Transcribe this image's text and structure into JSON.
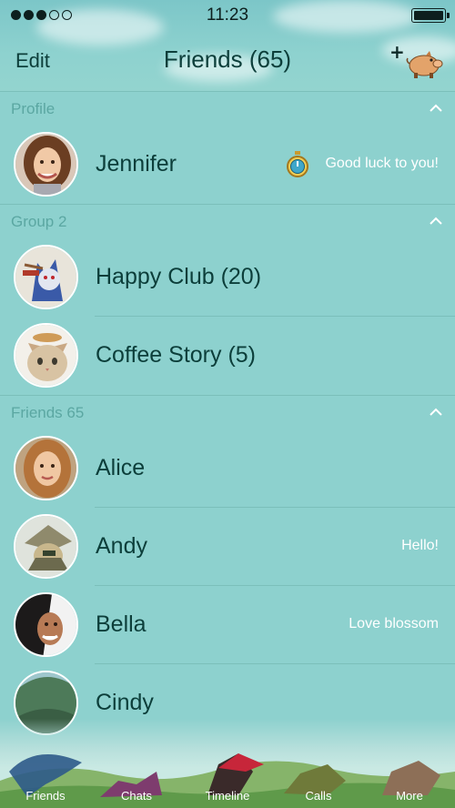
{
  "status_bar": {
    "time": "11:23",
    "signal_dots_filled": 3,
    "signal_dots_total": 5,
    "battery_level": 1.0
  },
  "nav": {
    "edit_label": "Edit",
    "title": "Friends (65)",
    "add_icon": "add-friend-pig-icon"
  },
  "sections": {
    "profile": {
      "label": "Profile"
    },
    "group": {
      "label": "Group 2"
    },
    "friends": {
      "label": "Friends 65"
    }
  },
  "profile": {
    "name": "Jennifer",
    "status": "Good luck to you!",
    "status_icon": "stopwatch-icon"
  },
  "groups": [
    {
      "name": "Happy Club (20)"
    },
    {
      "name": "Coffee Story (5)"
    }
  ],
  "friends": [
    {
      "name": "Alice",
      "status": ""
    },
    {
      "name": "Andy",
      "status": "Hello!"
    },
    {
      "name": "Bella",
      "status": "Love blossom"
    },
    {
      "name": "Cindy",
      "status": ""
    }
  ],
  "tabs": [
    {
      "label": "Friends",
      "icon": "friends-tab-icon",
      "active": true
    },
    {
      "label": "Chats",
      "icon": "chats-tab-icon",
      "active": false
    },
    {
      "label": "Timeline",
      "icon": "timeline-tab-icon",
      "active": false
    },
    {
      "label": "Calls",
      "icon": "calls-tab-icon",
      "active": false
    },
    {
      "label": "More",
      "icon": "more-tab-icon",
      "active": false
    }
  ],
  "colors": {
    "background": "#8dd1ce",
    "text": "#0c3e3a",
    "section_label": "#5ba7a2",
    "separator": "#7bbfba"
  }
}
